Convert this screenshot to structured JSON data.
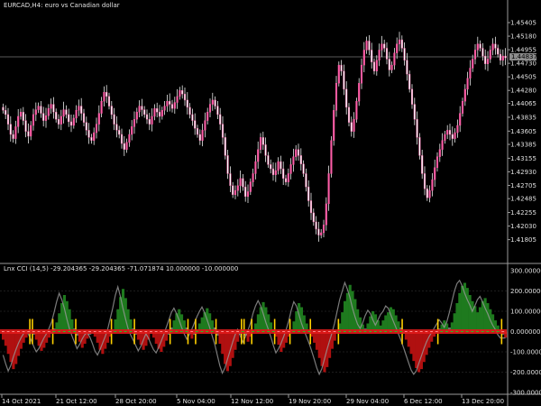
{
  "chart_title": "EURCAD,H4:  euro vs Canadian dollar",
  "indicator_title": "Lnx CCI (14,5) -29.204365 -29.204365 -71.071874 10.000000 -10.000000",
  "current_price_label": "1.44837",
  "colors": {
    "background": "#000000",
    "candle": "#ff5ea8",
    "candle_wick": "#e8e8e8",
    "grid": "#3a3a3a",
    "hist_up": "#1e7a1e",
    "hist_down": "#b01010",
    "hist_neutral": "#6e6e6e",
    "cci_line": "#9a9a9a",
    "signal_line": "#ffd000",
    "zero_band": "#e01a1a",
    "zero_band_green": "#22c422"
  },
  "chart_data": [
    {
      "type": "candlestick",
      "title": "EURCAD,H4:  euro vs Canadian dollar",
      "ylim": [
        1.415,
        1.456
      ],
      "y_ticks": [
        "1.45405",
        "1.45180",
        "1.44955",
        "1.44730",
        "1.44505",
        "1.44280",
        "1.44065",
        "1.43835",
        "1.43605",
        "1.43385",
        "1.43155",
        "1.42930",
        "1.42705",
        "1.42485",
        "1.42255",
        "1.42030",
        "1.41805"
      ],
      "close_series": [
        1.4395,
        1.4388,
        1.4372,
        1.4355,
        1.4348,
        1.4368,
        1.4385,
        1.4392,
        1.4378,
        1.436,
        1.4352,
        1.437,
        1.4388,
        1.4396,
        1.4402,
        1.439,
        1.4378,
        1.4386,
        1.4398,
        1.4405,
        1.4392,
        1.438,
        1.4372,
        1.4385,
        1.4396,
        1.4388,
        1.4376,
        1.437,
        1.4382,
        1.4395,
        1.4402,
        1.439,
        1.4375,
        1.4362,
        1.435,
        1.4345,
        1.4358,
        1.4372,
        1.439,
        1.441,
        1.4425,
        1.4418,
        1.4402,
        1.4388,
        1.4372,
        1.4362,
        1.4355,
        1.434,
        1.433,
        1.4342,
        1.4355,
        1.4368,
        1.438,
        1.4392,
        1.4402,
        1.4396,
        1.4388,
        1.438,
        1.4372,
        1.4385,
        1.4398,
        1.4392,
        1.4385,
        1.4395,
        1.4402,
        1.441,
        1.4405,
        1.4398,
        1.4408,
        1.4418,
        1.4428,
        1.4422,
        1.4412,
        1.44,
        1.4388,
        1.4378,
        1.4365,
        1.4355,
        1.4345,
        1.4362,
        1.4378,
        1.4392,
        1.4405,
        1.4412,
        1.4402,
        1.4388,
        1.4372,
        1.435,
        1.432,
        1.429,
        1.427,
        1.4255,
        1.4262,
        1.427,
        1.4282,
        1.4268,
        1.4252,
        1.426,
        1.4276,
        1.429,
        1.431,
        1.433,
        1.435,
        1.4338,
        1.432,
        1.4305,
        1.4298,
        1.4288,
        1.4295,
        1.431,
        1.4298,
        1.4282,
        1.4276,
        1.429,
        1.4305,
        1.4318,
        1.433,
        1.432,
        1.4306,
        1.429,
        1.4268,
        1.4245,
        1.4225,
        1.421,
        1.4198,
        1.4188,
        1.4192,
        1.4205,
        1.424,
        1.429,
        1.4345,
        1.4395,
        1.444,
        1.447,
        1.446,
        1.443,
        1.44,
        1.4375,
        1.436,
        1.438,
        1.441,
        1.444,
        1.447,
        1.4495,
        1.451,
        1.4495,
        1.4475,
        1.446,
        1.4478,
        1.4495,
        1.4505,
        1.4498,
        1.448,
        1.4462,
        1.447,
        1.449,
        1.4505,
        1.4512,
        1.4498,
        1.4478,
        1.4455,
        1.443,
        1.4405,
        1.438,
        1.435,
        1.432,
        1.429,
        1.4265,
        1.425,
        1.4262,
        1.428,
        1.43,
        1.4318,
        1.433,
        1.4345,
        1.4355,
        1.4362,
        1.4355,
        1.4348,
        1.4358,
        1.437,
        1.439,
        1.441,
        1.443,
        1.4448,
        1.4465,
        1.448,
        1.4495,
        1.4505,
        1.4498,
        1.4485,
        1.4472,
        1.448,
        1.4495,
        1.4505,
        1.4498,
        1.4488,
        1.4478,
        1.4485,
        1.4482
      ],
      "x_tick_labels": [
        "14 Oct 2021",
        "21 Oct 12:00",
        "28 Oct 20:00",
        "5 Nov 04:00",
        "12 Nov 12:00",
        "19 Nov 20:00",
        "29 Nov 04:00",
        "6 Dec 12:00",
        "13 Dec 20:00"
      ]
    },
    {
      "type": "histogram",
      "title": "Lnx CCI (14,5) -29.204365 -29.204365 -71.071874 10.000000 -10.000000",
      "ylim": [
        -300,
        300
      ],
      "y_ticks": [
        "300.000000",
        "200.000000",
        "100.000000",
        "0.000000",
        "-100.000000",
        "-200.000000",
        "-300.000000"
      ],
      "values": [
        -40,
        -70,
        -110,
        -150,
        -185,
        -160,
        -120,
        -85,
        -55,
        -30,
        -10,
        5,
        -15,
        -40,
        -70,
        -95,
        -80,
        -55,
        -30,
        -10,
        15,
        45,
        90,
        140,
        180,
        150,
        110,
        60,
        15,
        -20,
        -50,
        -80,
        -60,
        -35,
        -15,
        -5,
        -25,
        -55,
        -90,
        -110,
        -85,
        -55,
        -25,
        10,
        60,
        110,
        170,
        210,
        165,
        110,
        60,
        15,
        -15,
        -40,
        -65,
        -90,
        -70,
        -40,
        -10,
        -30,
        -60,
        -85,
        -100,
        -75,
        -45,
        -15,
        20,
        55,
        90,
        110,
        85,
        55,
        20,
        -10,
        -35,
        -15,
        10,
        40,
        70,
        95,
        115,
        90,
        55,
        20,
        -20,
        -60,
        -110,
        -160,
        -195,
        -170,
        -130,
        -90,
        -50,
        -15,
        10,
        -20,
        -50,
        -25,
        5,
        40,
        85,
        120,
        145,
        120,
        85,
        45,
        10,
        -25,
        -65,
        -100,
        -80,
        -55,
        -25,
        10,
        50,
        100,
        140,
        120,
        80,
        40,
        5,
        -25,
        -55,
        -90,
        -130,
        -170,
        -200,
        -175,
        -130,
        -85,
        -45,
        -5,
        40,
        95,
        150,
        190,
        230,
        200,
        160,
        110,
        70,
        35,
        15,
        40,
        75,
        100,
        85,
        55,
        30,
        55,
        80,
        95,
        120,
        110,
        80,
        50,
        20,
        -10,
        -40,
        -75,
        -110,
        -145,
        -180,
        -200,
        -185,
        -150,
        -115,
        -80,
        -50,
        -25,
        -5,
        15,
        35,
        55,
        40,
        20,
        45,
        90,
        140,
        190,
        225,
        240,
        215,
        180,
        150,
        125,
        95,
        120,
        150,
        165,
        140,
        110,
        85,
        55,
        30,
        10,
        -15,
        -30
      ]
    }
  ]
}
